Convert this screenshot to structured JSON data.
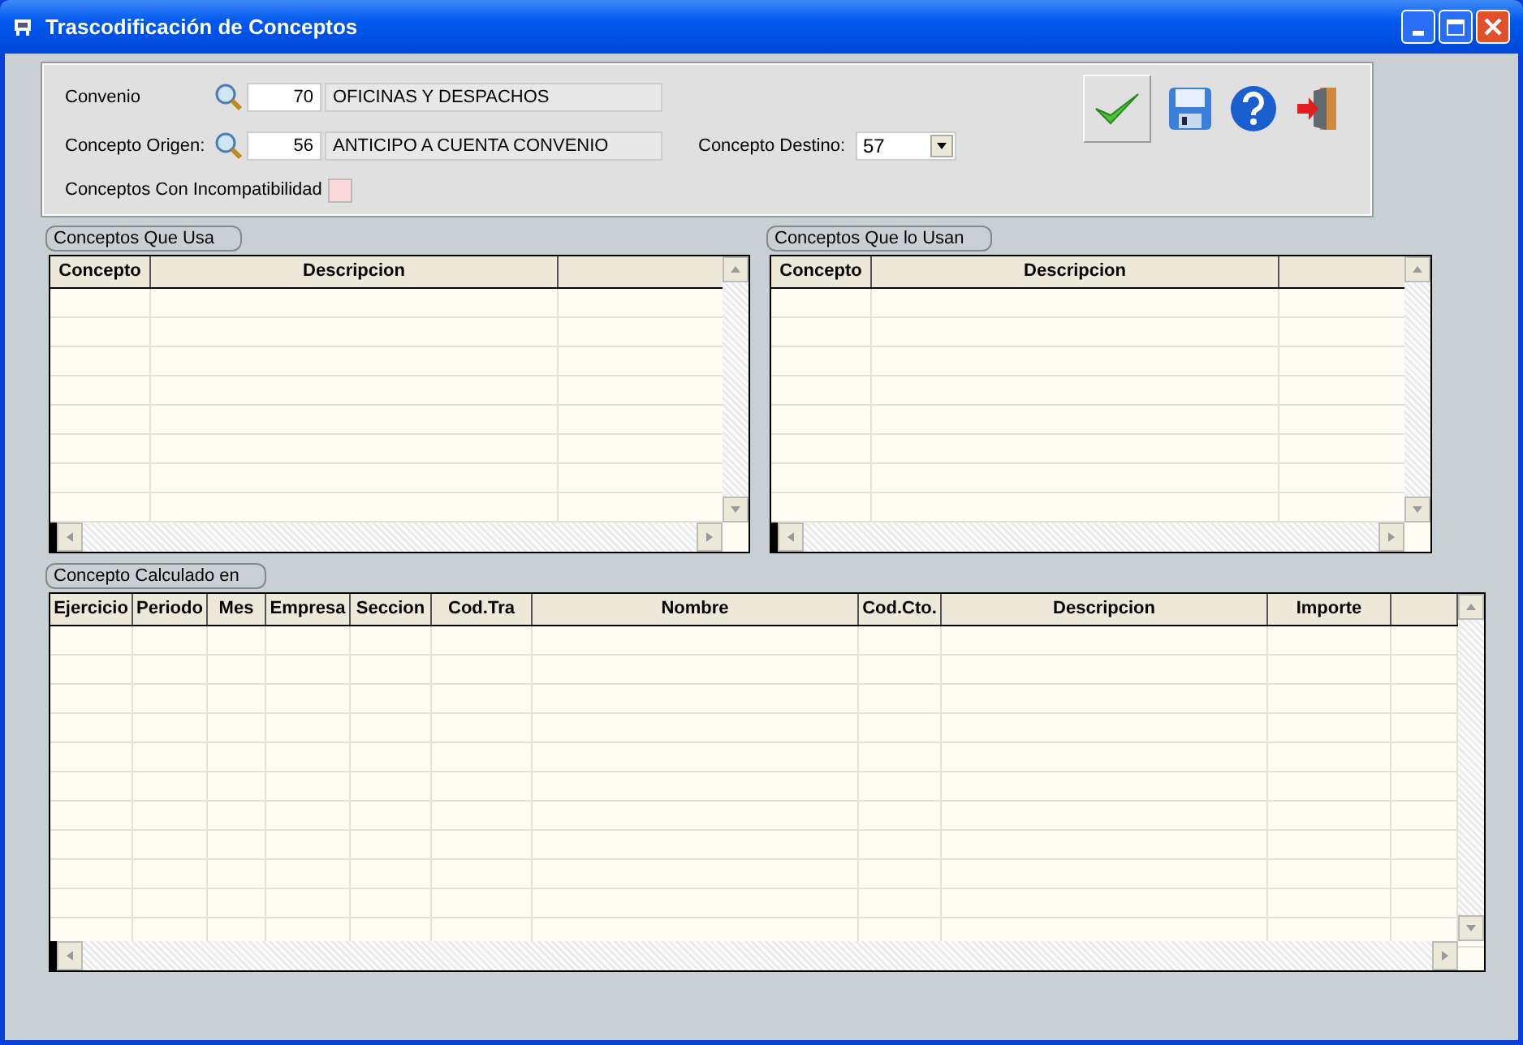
{
  "window": {
    "title": "Trascodificación de Conceptos"
  },
  "form": {
    "convenio": {
      "label": "Convenio",
      "code": "70",
      "description": "OFICINAS Y DESPACHOS"
    },
    "origen": {
      "label": "Concepto Origen:",
      "code": "56",
      "description": "ANTICIPO A CUENTA CONVENIO"
    },
    "destino": {
      "label": "Concepto Destino:",
      "value": "57"
    },
    "incompatibilidad": {
      "label": "Conceptos Con Incompatibilidad",
      "checked": false
    }
  },
  "grids": [
    {
      "title": "Conceptos Que Usa",
      "columns": [
        "Concepto",
        "Descripcion"
      ]
    },
    {
      "title": "Conceptos Que lo Usan",
      "columns": [
        "Concepto",
        "Descripcion"
      ]
    },
    {
      "title": "Concepto Calculado en",
      "columns": [
        "Ejercicio",
        "Periodo",
        "Mes",
        "Empresa",
        "Seccion",
        "Cod.Tra",
        "Nombre",
        "Cod.Cto.",
        "Descripcion",
        "Importe"
      ]
    }
  ]
}
